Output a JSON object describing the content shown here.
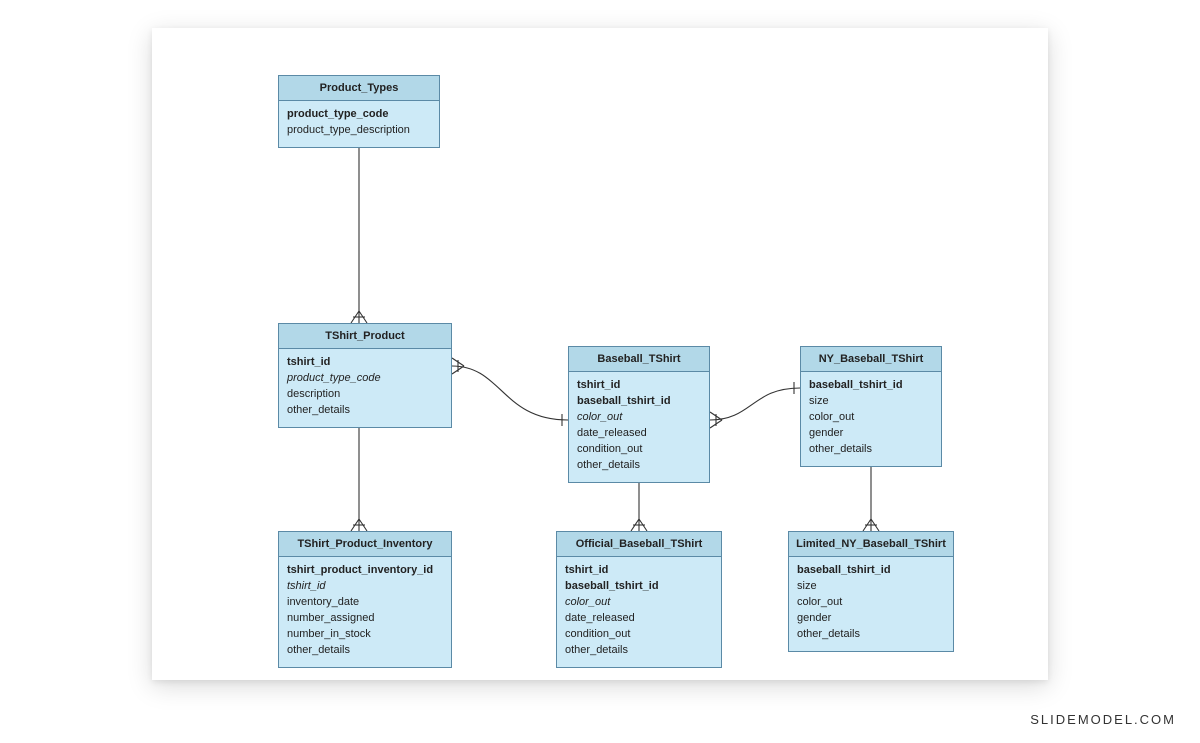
{
  "watermark": "SLIDEMODEL.COM",
  "entities": {
    "product_types": {
      "title": "Product_Types",
      "attrs": [
        {
          "text": "product_type_code",
          "bold": true
        },
        {
          "text": "product_type_description"
        }
      ]
    },
    "tshirt_product": {
      "title": "TShirt_Product",
      "attrs": [
        {
          "text": "tshirt_id",
          "bold": true
        },
        {
          "text": "product_type_code",
          "italic": true
        },
        {
          "text": "description"
        },
        {
          "text": "other_details"
        }
      ]
    },
    "baseball_tshirt": {
      "title": "Baseball_TShirt",
      "attrs": [
        {
          "text": "tshirt_id",
          "bold": true
        },
        {
          "text": "baseball_tshirt_id",
          "bold": true
        },
        {
          "text": "color_out",
          "italic": true
        },
        {
          "text": "date_released"
        },
        {
          "text": "condition_out"
        },
        {
          "text": "other_details"
        }
      ]
    },
    "ny_baseball_tshirt": {
      "title": "NY_Baseball_TShirt",
      "attrs": [
        {
          "text": "baseball_tshirt_id",
          "bold": true
        },
        {
          "text": "size"
        },
        {
          "text": "color_out"
        },
        {
          "text": "gender"
        },
        {
          "text": "other_details"
        }
      ]
    },
    "tshirt_product_inventory": {
      "title": "TShirt_Product_Inventory",
      "attrs": [
        {
          "text": "tshirt_product_inventory_id",
          "bold": true
        },
        {
          "text": "tshirt_id",
          "italic": true
        },
        {
          "text": "inventory_date"
        },
        {
          "text": "number_assigned"
        },
        {
          "text": "number_in_stock"
        },
        {
          "text": "other_details"
        }
      ]
    },
    "official_baseball_tshirt": {
      "title": "Official_Baseball_TShirt",
      "attrs": [
        {
          "text": "tshirt_id",
          "bold": true
        },
        {
          "text": "baseball_tshirt_id",
          "bold": true
        },
        {
          "text": "color_out",
          "italic": true
        },
        {
          "text": "date_released"
        },
        {
          "text": "condition_out"
        },
        {
          "text": "other_details"
        }
      ]
    },
    "limited_ny_baseball_tshirt": {
      "title": "Limited_NY_Baseball_TShirt",
      "attrs": [
        {
          "text": "baseball_tshirt_id",
          "bold": true
        },
        {
          "text": "size"
        },
        {
          "text": "color_out"
        },
        {
          "text": "gender"
        },
        {
          "text": "other_details"
        }
      ]
    }
  }
}
